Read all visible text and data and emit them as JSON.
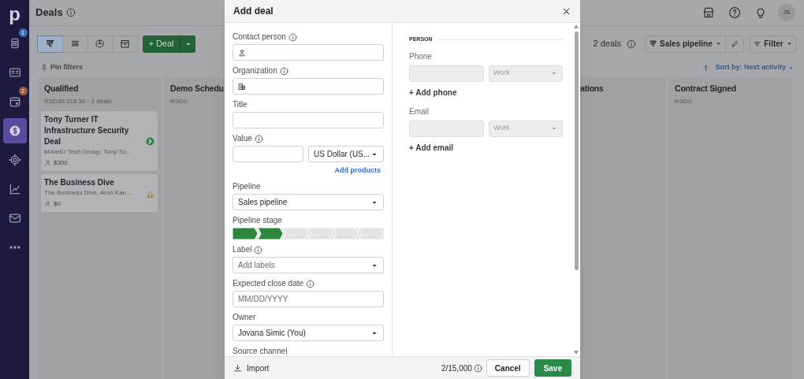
{
  "sidebar": {
    "logo": "p",
    "items": [
      {
        "badge": "1",
        "color": "#3d6fb0",
        "selected": false
      },
      {
        "selected": false
      },
      {
        "badge": "2",
        "color": "#9a5a3e",
        "selected": false
      },
      {
        "selected": true
      },
      {
        "selected": false
      },
      {
        "selected": false
      },
      {
        "selected": false
      },
      {
        "selected": false
      }
    ]
  },
  "header": {
    "title": "Deals",
    "avatar": "JS"
  },
  "toolbar": {
    "views": [
      {
        "selected": true
      },
      {
        "selected": false
      },
      {
        "selected": false
      },
      {
        "selected": false
      }
    ],
    "add_button": "+ Deal",
    "count": "2 deals",
    "pipeline": "Sales pipeline",
    "filter": "Filter",
    "pin_filters": "Pin filters",
    "sort": "Sort by: Next activity"
  },
  "board": {
    "columns": [
      {
        "title": "Qualified",
        "subtitle": "RSD30,318.30 · 2 deals",
        "deals": [
          {
            "title": "Tony Turner IT Infrastructure Security Deal",
            "subtitle": "MoveEr Tech Group, Tony Tu...",
            "value": "$300",
            "kind": "activity"
          },
          {
            "title": "The Business Dive",
            "subtitle": "The Business Dive, Aron Kan...",
            "value": "$0",
            "kind": "warning"
          }
        ]
      },
      {
        "title": "Demo Schedu",
        "subtitle": "RSD0"
      },
      {
        "title": "ations"
      },
      {
        "title": "Contract Signed",
        "subtitle": "RSD0"
      }
    ]
  },
  "modal": {
    "title": "Add deal",
    "fields": [
      {
        "kind": "person",
        "label": "Contact person",
        "info": true
      },
      {
        "kind": "organization",
        "label": "Organization",
        "info": true
      },
      {
        "kind": "input",
        "label": "Title",
        "info": false
      },
      {
        "kind": "value",
        "label": "Value",
        "info": true,
        "currency": "US Dollar (US...",
        "link": "Add products"
      },
      {
        "kind": "select",
        "label": "Pipeline",
        "info": false,
        "value": "Sales pipeline"
      },
      {
        "kind": "stages",
        "label": "Pipeline stage",
        "info": false,
        "stages": [
          {
            "reached": true
          },
          {
            "reached": true
          },
          {
            "reached": false
          },
          {
            "reached": false
          },
          {
            "reached": false
          },
          {
            "reached": false
          }
        ]
      },
      {
        "kind": "select",
        "label": "Label",
        "info": true,
        "placeholder": "Add labels"
      },
      {
        "kind": "input",
        "label": "Expected close date",
        "info": true,
        "placeholder": "MM/DD/YYYY"
      },
      {
        "kind": "select",
        "label": "Owner",
        "info": false,
        "value": "Jovana Simic (You)"
      },
      {
        "kind": "heading",
        "label": "Source channel",
        "info": false
      }
    ],
    "person": {
      "section": "PERSON",
      "groups": [
        {
          "label": "Phone",
          "type": "Work",
          "add": "+ Add phone",
          "disabled": true
        },
        {
          "label": "Email",
          "type": "Work",
          "add": "+ Add email",
          "disabled": true
        }
      ]
    },
    "footer": {
      "import": "Import",
      "counter": "2/15,000",
      "cancel": "Cancel",
      "save": "Save"
    }
  }
}
